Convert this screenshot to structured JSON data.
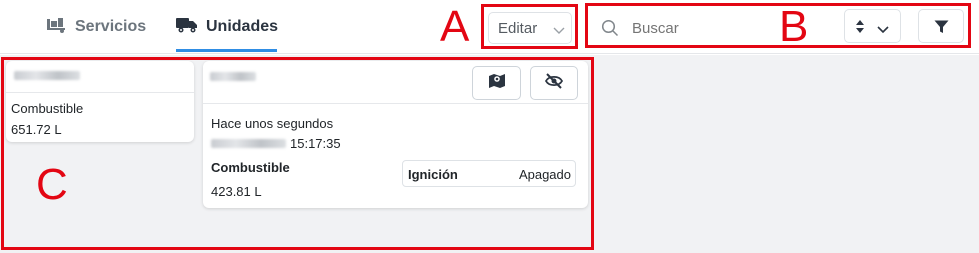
{
  "tabs": [
    {
      "label": "Servicios",
      "icon": "truck-loading-icon",
      "active": false
    },
    {
      "label": "Unidades",
      "icon": "truck-icon",
      "active": true
    }
  ],
  "toolbar": {
    "edit_label": "Editar",
    "search_placeholder": "Buscar",
    "sort_icon": "sort-icon",
    "filter_icon": "filter-icon"
  },
  "cards": [
    {
      "fuel_label": "Combustible",
      "fuel_value": "651.72 L"
    },
    {
      "map_icon": "map-icon",
      "hide_icon": "eye-slash-icon",
      "last_update": "Hace unos segundos",
      "time": "15:17:35",
      "fuel_label": "Combustible",
      "fuel_value": "423.81 L",
      "ignition_label": "Ignición",
      "ignition_value": "Apagado"
    }
  ],
  "annotations": [
    "A",
    "B",
    "C"
  ],
  "colors": {
    "annotation": "#e30613",
    "active_tab_underline": "#2f8de4",
    "background": "#f1f2f4"
  }
}
